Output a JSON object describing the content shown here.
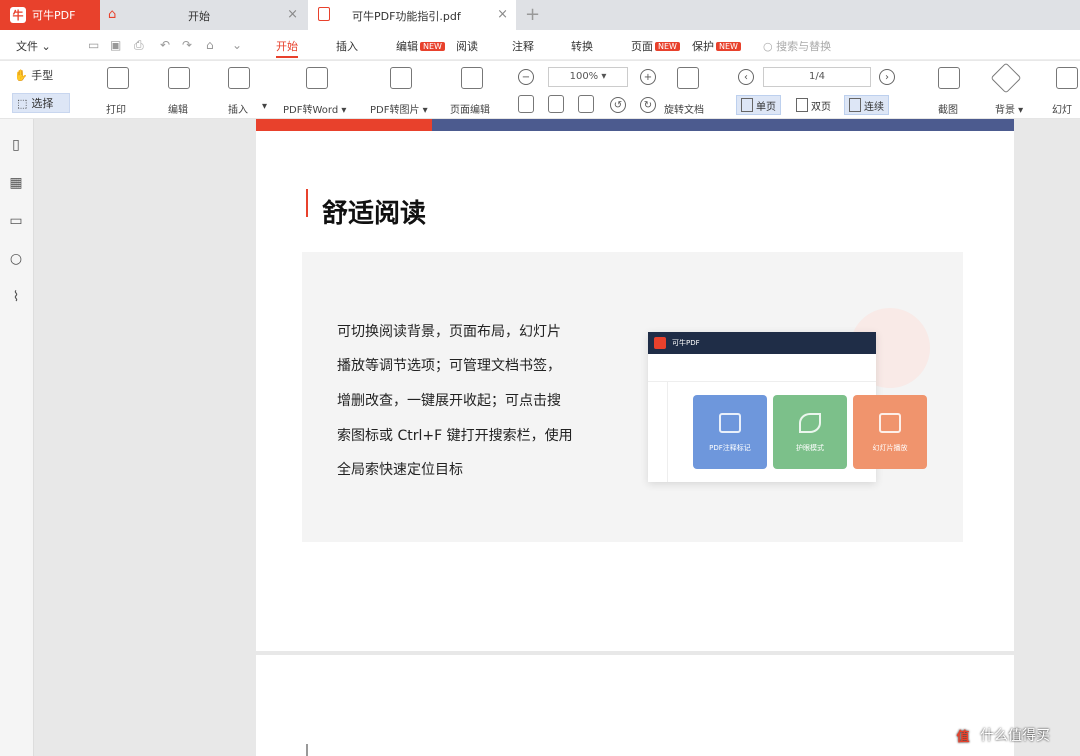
{
  "app": {
    "name": "可牛PDF"
  },
  "tabs": [
    {
      "label": "开始"
    },
    {
      "label": "可牛PDF功能指引.pdf"
    }
  ],
  "newtab_glyph": "+",
  "close_glyph": "×",
  "menu": {
    "file": "文件",
    "start": "开始",
    "insert": "插入",
    "edit": "编辑",
    "read": "阅读",
    "annotate": "注释",
    "convert": "转换",
    "page": "页面",
    "protect": "保护",
    "new_badge": "NEW",
    "search": "搜索与替换"
  },
  "toolbar": {
    "hand": "手型",
    "select": "选择",
    "print": "打印",
    "edit": "编辑",
    "insert": "插入",
    "pdf_to_word": "PDF转Word",
    "pdf_to_image": "PDF转图片",
    "page_edit": "页面编辑",
    "zoom": "100%",
    "rotate": "旋转文档",
    "page_indicator": "1/4",
    "single": "单页",
    "double": "双页",
    "continuous": "连续",
    "screenshot": "截图",
    "background": "背景",
    "slideshow": "幻灯"
  },
  "doc": {
    "heading": "舒适阅读",
    "paragraph": [
      "可切换阅读背景，页面布局，幻灯片",
      "播放等调节选项；可管理文档书签，",
      "增删改查，一键展开收起；可点击搜",
      "索图标或 Ctrl+F 键打开搜索栏，使用",
      "全局索快速定位目标"
    ],
    "mini_title": "可牛PDF",
    "cards": [
      "PDF注释标记",
      "护眼模式",
      "幻灯片播放"
    ]
  },
  "watermark": "什么值得买",
  "colors": {
    "accent": "#e8412c",
    "navy": "#4c5b8f",
    "select_bg": "#dde6f6"
  }
}
